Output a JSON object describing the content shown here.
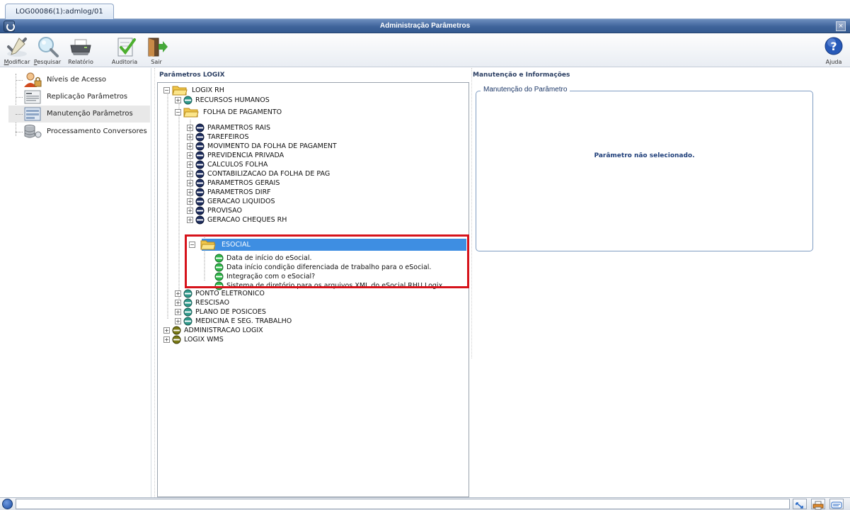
{
  "window": {
    "tab_label": "LOG00086(1):admlog/01",
    "title": "Administração Parâmetros",
    "close_glyph": "×"
  },
  "toolbar": {
    "modify": {
      "accel": "M",
      "rest": "odificar"
    },
    "search": {
      "accel": "P",
      "rest": "esquisar"
    },
    "report": "Relatório",
    "audit": "Auditoria",
    "exit": "Sair",
    "help": "Ajuda"
  },
  "sidebar": {
    "items": [
      {
        "label": "Níveis de Acesso",
        "icon": "user-lock-icon"
      },
      {
        "label": "Replicação Parâmetros",
        "icon": "document-list-icon"
      },
      {
        "label": "Manutenção Parâmetros",
        "icon": "form-icon"
      },
      {
        "label": "Processamento Conversores",
        "icon": "database-icon"
      }
    ],
    "selected_index": 2
  },
  "params_panel": {
    "title": "Parâmetros LOGIX",
    "tree": {
      "root": "LOGIX RH",
      "recursos_humanos": "RECURSOS HUMANOS",
      "folha": "FOLHA DE PAGAMENTO",
      "folha_children": [
        "PARAMETROS RAIS",
        "TAREFEIROS",
        "MOVIMENTO DA FOLHA DE PAGAMENT",
        "PREVIDENCIA PRIVADA",
        "CALCULOS FOLHA",
        "CONTABILIZACAO DA FOLHA DE PAG",
        "PARAMETROS GERAIS",
        "PARAMETROS DIRF",
        "GERACAO LIQUIDOS",
        "PROVISAO",
        "GERACAO CHEQUES RH"
      ],
      "esocial": "ESOCIAL",
      "esocial_children": [
        "Data de início do eSocial.",
        "Data início condição diferenciada de trabalho para o eSocial.",
        "Integração com o eSocial?",
        "Sistema de diretório para os arquivos XML do eSocial RHU Logix"
      ],
      "rh_after": [
        "PONTO ELETRONICO",
        "RESCISAO",
        "PLANO DE POSICOES",
        "MEDICINA E SEG. TRABALHO"
      ],
      "top_level": [
        "ADMINISTRACAO LOGIX",
        "LOGIX WMS"
      ],
      "expand_glyph": "+",
      "collapse_glyph": "−"
    }
  },
  "info_panel": {
    "title": "Manutenção e Informações",
    "group_label": "Manutenção do Parâmetro",
    "empty_message": "Parâmetro não selecionado."
  },
  "colors": {
    "titlebar": "#3f649b",
    "selection": "#3e8ee2",
    "highlight_frame": "#d6131b",
    "leaf_green": "#2fb84a",
    "node_navy": "#1c2c5e",
    "node_teal": "#2f9a8c",
    "node_olive": "#7a7a14"
  }
}
